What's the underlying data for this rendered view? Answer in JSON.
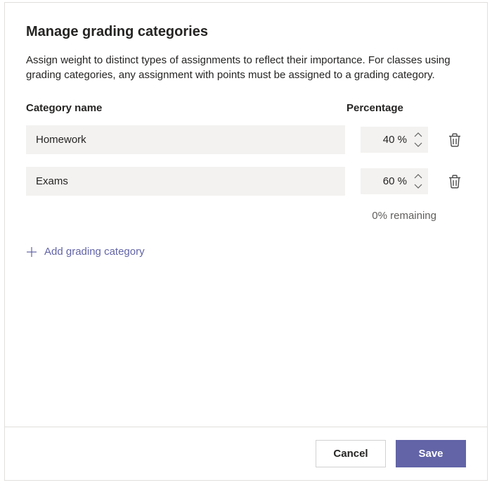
{
  "dialog": {
    "title": "Manage grading categories",
    "description": "Assign weight to distinct types of assignments to reflect their importance. For classes using grading categories, any assignment with points must be assigned to a grading category."
  },
  "headers": {
    "name": "Category name",
    "percent": "Percentage"
  },
  "categories": [
    {
      "name": "Homework",
      "percent": "40 %"
    },
    {
      "name": "Exams",
      "percent": "60 %"
    }
  ],
  "remaining": "0% remaining",
  "actions": {
    "add": "Add grading category",
    "cancel": "Cancel",
    "save": "Save"
  }
}
